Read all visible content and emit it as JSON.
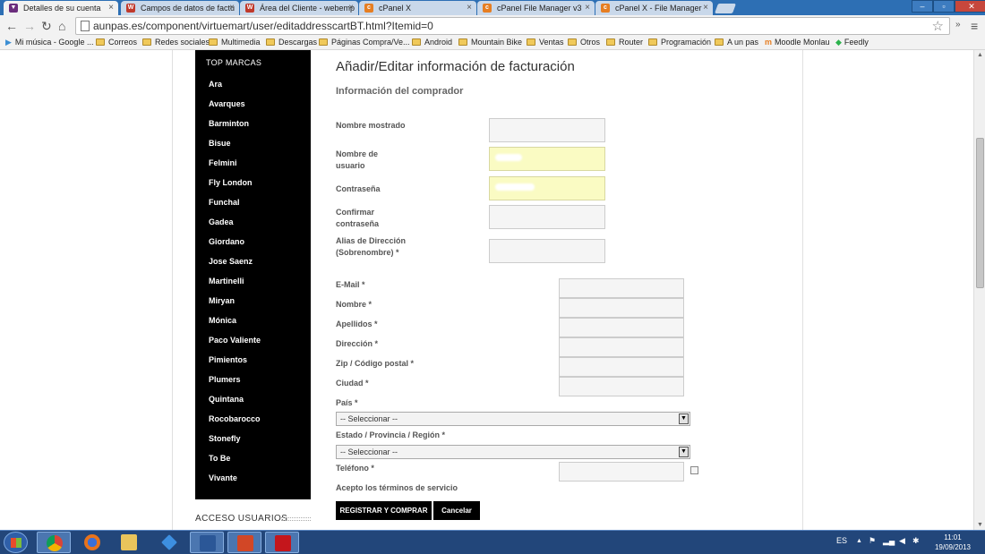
{
  "browser": {
    "tabs": [
      {
        "title": "Detalles de su cuenta",
        "active": true,
        "favicon_color": "#6b2d7d"
      },
      {
        "title": "Campos de datos de factu",
        "active": false,
        "favicon_color": "#c0392b"
      },
      {
        "title": "Área del Cliente - webemp",
        "active": false,
        "favicon_color": "#c0392b"
      },
      {
        "title": "cPanel X",
        "active": false,
        "favicon_color": "#e67e22"
      },
      {
        "title": "cPanel File Manager v3",
        "active": false,
        "favicon_color": "#e67e22"
      },
      {
        "title": "cPanel X - File Manager",
        "active": false,
        "favicon_color": "#e67e22"
      }
    ],
    "tab_close": "×",
    "url": "aunpas.es/component/virtuemart/user/editaddresscartBT.html?Itemid=0",
    "nav": {
      "back": "←",
      "forward": "→",
      "reload": "↻",
      "home": "⌂"
    },
    "star_icon": "☆",
    "menu_icon": "≡",
    "chevron": "»",
    "window_buttons": {
      "minimize": "–",
      "maximize": "▫",
      "close": "✕"
    },
    "bookmarks": [
      {
        "label": "Mi música - Google ...",
        "icon": "play-icon"
      },
      {
        "label": "Correos",
        "icon": "folder-icon"
      },
      {
        "label": "Redes sociales",
        "icon": "folder-icon"
      },
      {
        "label": "Multimedia",
        "icon": "folder-icon"
      },
      {
        "label": "Descargas",
        "icon": "folder-icon"
      },
      {
        "label": "Páginas Compra/Ve...",
        "icon": "folder-icon"
      },
      {
        "label": "Android",
        "icon": "folder-icon"
      },
      {
        "label": "Mountain Bike",
        "icon": "folder-icon"
      },
      {
        "label": "Ventas",
        "icon": "folder-icon"
      },
      {
        "label": "Otros",
        "icon": "folder-icon"
      },
      {
        "label": "Router",
        "icon": "folder-icon"
      },
      {
        "label": "Programación",
        "icon": "folder-icon"
      },
      {
        "label": "A un pas",
        "icon": "folder-icon"
      },
      {
        "label": "Moodle Monlau",
        "icon": "moodle-icon"
      },
      {
        "label": "Feedly",
        "icon": "feedly-icon"
      }
    ]
  },
  "sidebar": {
    "title": "TOP MARCAS",
    "brands": [
      "Ara",
      "Avarques",
      "Barminton",
      "Bisue",
      "Felmini",
      "Fly London",
      "Funchal",
      "Gadea",
      "Giordano",
      "Jose Saenz",
      "Martinelli",
      "Miryan",
      "Mónica",
      "Paco Valiente",
      "Pimientos",
      "Plumers",
      "Quintana",
      "Rocobarocco",
      "Stonefly",
      "To Be",
      "Vivante"
    ],
    "acceso_title": "ACCESO USUARIOS"
  },
  "form": {
    "title": "Añadir/Editar información de facturación",
    "subtitle": "Información del comprador",
    "labels": {
      "display_name": "Nombre mostrado",
      "username": "Nombre de usuario",
      "password": "Contraseña",
      "confirm_password": "Confirmar contraseña",
      "address_alias": "Alias de Dirección (Sobrenombre) *",
      "email": "E-Mail *",
      "first_name": "Nombre *",
      "last_name": "Apellidos *",
      "address": "Dirección *",
      "zip": "Zip / Código postal *",
      "city": "Ciudad *",
      "country": "País *",
      "state": "Estado / Provincia / Región *",
      "phone": "Teléfono *",
      "terms": "Acepto los términos de servicio"
    },
    "selects": {
      "country_value": "-- Seleccionar --",
      "state_value": "-- Seleccionar --",
      "arrow": "▼"
    },
    "buttons": {
      "register": "REGISTRAR Y COMPRAR",
      "cancel": "Cancelar"
    }
  },
  "scrollbar": {
    "up": "▲",
    "down": "▼"
  },
  "taskbar": {
    "apps": [
      "chrome",
      "firefox",
      "explorer",
      "dropbox",
      "word",
      "powerpoint",
      "acrobat"
    ],
    "language": "ES",
    "time": "11:01",
    "date": "19/09/2013"
  }
}
